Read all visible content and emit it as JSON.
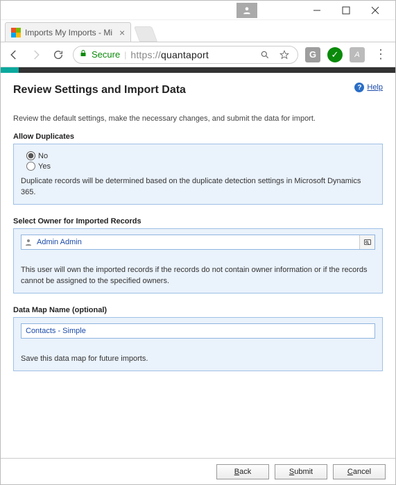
{
  "window": {
    "tab_title": "Imports My Imports - Mi",
    "url_scheme": "https",
    "url_host": "quantaport",
    "secure_label": "Secure",
    "ext_g": "G"
  },
  "page": {
    "title": "Review Settings and Import Data",
    "help_label": "Help",
    "intro": "Review the default settings, make the necessary changes, and submit the data for import."
  },
  "duplicates": {
    "section_label": "Allow Duplicates",
    "option_no": "No",
    "option_yes": "Yes",
    "selected": "No",
    "hint": "Duplicate records will be determined based on the duplicate detection settings in Microsoft Dynamics 365."
  },
  "owner": {
    "section_label": "Select Owner for Imported Records",
    "value": "Admin Admin",
    "hint": "This user will own the imported records if the records do not contain owner information or if the records cannot be assigned to the specified owners."
  },
  "datamap": {
    "section_label": "Data Map Name (optional)",
    "value": "Contacts - Simple",
    "hint": "Save this data map for future imports."
  },
  "footer": {
    "back": "Back",
    "submit": "Submit",
    "cancel": "Cancel"
  }
}
